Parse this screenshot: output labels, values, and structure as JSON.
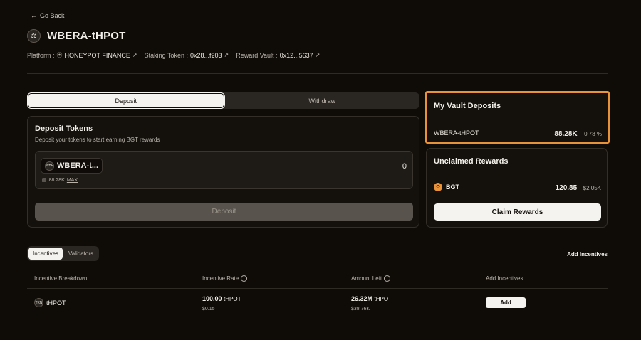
{
  "nav": {
    "back_label": "Go Back"
  },
  "header": {
    "title": "WBERA-tHPOT",
    "platform_label": "Platform :",
    "platform_value": "HONEYPOT FINANCE",
    "staking_label": "Staking Token :",
    "staking_value": "0x28...f203",
    "vault_label": "Reward Vault :",
    "vault_value": "0x12...5637"
  },
  "tabs": {
    "deposit": "Deposit",
    "withdraw": "Withdraw"
  },
  "deposit_card": {
    "title": "Deposit Tokens",
    "subtitle": "Deposit your tokens to start earning BGT rewards",
    "token_label": "WBERA-t...",
    "token_icon_text": "WBE",
    "balance": "88.28K",
    "max_label": "MAX",
    "amount": "0",
    "button_label": "Deposit"
  },
  "vault_card": {
    "title": "My Vault Deposits",
    "token": "WBERA-tHPOT",
    "amount": "88.28K",
    "percent": "0.78 %"
  },
  "rewards_card": {
    "title": "Unclaimed Rewards",
    "token": "BGT",
    "amount": "120.85",
    "usd": "$2.05K",
    "button_label": "Claim Rewards"
  },
  "incentives": {
    "tabs": [
      "Incentives",
      "Validators"
    ],
    "add_link": "Add Incentives",
    "columns": [
      "Incentive Breakdown",
      "Incentive Rate",
      "Amount Left",
      "Add Incentives"
    ],
    "rows": [
      {
        "token": "tHPOT",
        "token_icon_text": "TKN",
        "rate": "100.00",
        "rate_unit": "tHPOT",
        "rate_usd": "$0.15",
        "left": "26.32M",
        "left_unit": "tHPOT",
        "left_usd": "$38.76K",
        "button_label": "Add"
      }
    ]
  },
  "colors": {
    "accent": "#e8923a",
    "background": "#0f0c08"
  }
}
